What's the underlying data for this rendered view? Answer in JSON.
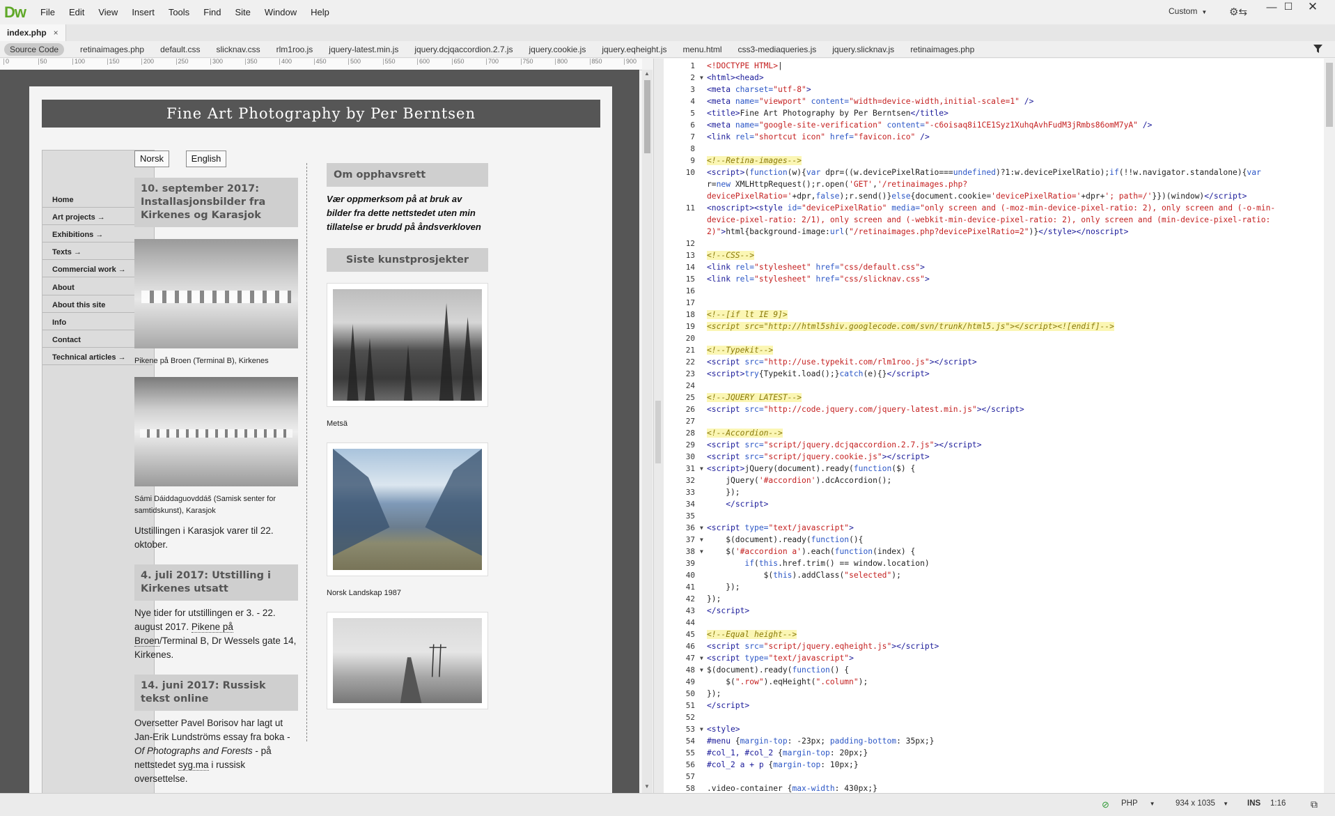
{
  "app": {
    "logo": "Dw",
    "menus": [
      "File",
      "Edit",
      "View",
      "Insert",
      "Tools",
      "Find",
      "Site",
      "Window",
      "Help"
    ],
    "workspace": "Custom",
    "icons": {
      "sync": "gear-sync-icon",
      "minimize": "minimize-icon",
      "maximize": "maximize-icon",
      "close": "close-icon",
      "filter": "filter-icon"
    }
  },
  "document_tab": {
    "label": "index.php",
    "close": "×"
  },
  "related_files": [
    "Source Code",
    "retinaimages.php",
    "default.css",
    "slicknav.css",
    "rlm1roo.js",
    "jquery-latest.min.js",
    "jquery.dcjqaccordion.2.7.js",
    "jquery.cookie.js",
    "jquery.eqheight.js",
    "menu.html",
    "css3-mediaqueries.js",
    "jquery.slicknav.js",
    "retinaimages.php"
  ],
  "ruler_ticks": [
    "0",
    "50",
    "100",
    "150",
    "200",
    "250",
    "300",
    "350",
    "400",
    "450",
    "500",
    "550",
    "600",
    "650",
    "700",
    "750",
    "800",
    "850",
    "900"
  ],
  "site": {
    "title": "Fine Art Photography by Per Berntsen",
    "nav": [
      "Home",
      "Art projects →",
      "Exhibitions →",
      "Texts →",
      "Commercial work →",
      "About",
      "About this site",
      "Info",
      "Contact",
      "Technical articles →"
    ],
    "lang_buttons": [
      "Norsk",
      "English"
    ],
    "news": [
      {
        "heading": "10. september 2017: Installasjonsbilder fra Kirkenes og Karasjok"
      },
      {
        "caption1": "Pikene på Broen (Terminal B), Kirkenes"
      },
      {
        "caption2": "Sámi Dáiddaguovddáš (Samisk senter for samtidskunst), Karasjok"
      },
      {
        "text": "Utstillingen i Karasjok varer til 22. oktober."
      },
      {
        "heading": "4. juli 2017: Utstilling i Kirkenes utsatt"
      },
      {
        "text_a": "Nye tider for utstillingen er 3. - 22. august 2017.",
        "text_b": "Pikene på Broen",
        "text_c": "/Terminal B, Dr Wessels gate 14, Kirkenes."
      },
      {
        "heading": "14. juni 2017: Russisk tekst online"
      },
      {
        "text_a": "Oversetter Pavel Borisov har lagt ut Jan-Erik Lundströms essay fra boka - ",
        "text_b": "Of Photographs and Forests",
        "text_c": " - på nettstedet ",
        "text_d": "syg.ma",
        "text_e": " i russisk oversettelse."
      }
    ],
    "sidebar": {
      "copyright_heading": "Om opphavsrett",
      "copyright_text": "Vær oppmerksom på at bruk av bilder fra dette nettstedet uten min tillatelse er brudd på åndsverkloven",
      "projects_heading": "Siste kunstprosjekter",
      "captions": [
        "Metsä",
        "Norsk Landskap 1987"
      ]
    }
  },
  "code": [
    {
      "n": "1",
      "f": "",
      "html": "<span class='dt'>&lt;!DOCTYPE HTML&gt;</span>|"
    },
    {
      "n": "2",
      "f": "▼",
      "html": "<span class='tag'>&lt;html&gt;&lt;head&gt;</span>"
    },
    {
      "n": "3",
      "f": "",
      "html": "<span class='tag'>&lt;meta</span> <span class='kw'>charset=</span><span class='str'>\"utf-8\"</span><span class='tag'>&gt;</span>"
    },
    {
      "n": "4",
      "f": "",
      "html": "<span class='tag'>&lt;meta</span> <span class='kw'>name=</span><span class='str'>\"viewport\"</span> <span class='kw'>content=</span><span class='str'>\"width=device-width,initial-scale=1\"</span> <span class='tag'>/&gt;</span>"
    },
    {
      "n": "5",
      "f": "",
      "html": "<span class='tag'>&lt;title&gt;</span>Fine Art Photography by Per Berntsen<span class='tag'>&lt;/title&gt;</span>"
    },
    {
      "n": "6",
      "f": "",
      "html": "<span class='tag'>&lt;meta</span> <span class='kw'>name=</span><span class='str'>\"google-site-verification\"</span> <span class='kw'>content=</span><span class='str'>\"-c6oisaq8i1CE1Syz1XuhqAvhFudM3jRmbs86omM7yA\"</span> <span class='tag'>/&gt;</span>"
    },
    {
      "n": "7",
      "f": "",
      "html": "<span class='tag'>&lt;link</span> <span class='kw'>rel=</span><span class='str'>\"shortcut icon\"</span> <span class='kw'>href=</span><span class='str'>\"favicon.ico\"</span> <span class='tag'>/&gt;</span>"
    },
    {
      "n": "8",
      "f": "",
      "html": ""
    },
    {
      "n": "9",
      "f": "",
      "html": "<span class='cm'>&lt;!--Retina-images--&gt;</span>"
    },
    {
      "n": "10",
      "f": "",
      "html": "<span class='tag'>&lt;script&gt;</span>(<span class='kw'>function</span>(w){<span class='kw'>var</span> dpr=((w.devicePixelRatio===<span class='kw'>undefined</span>)?1:w.devicePixelRatio);<span class='kw'>if</span>(!!w.navigator.standalone){<span class='kw'>var</span>"
    },
    {
      "n": "",
      "f": "",
      "html": "r=<span class='kw'>new</span> XMLHttpRequest();r.open(<span class='str'>'GET'</span>,<span class='str'>'/retinaimages.php?</span>"
    },
    {
      "n": "",
      "f": "",
      "html": "<span class='str'>devicePixelRatio='</span>+dpr,<span class='kw'>false</span>);r.send()}<span class='kw'>else</span>{document.cookie=<span class='str'>'devicePixelRatio='</span>+dpr+<span class='str'>'; path=/'</span>}})(window)<span class='tag'>&lt;/script&gt;</span>"
    },
    {
      "n": "11",
      "f": "",
      "html": "<span class='tag'>&lt;noscript&gt;&lt;style</span> <span class='kw'>id=</span><span class='str'>\"devicePixelRatio\"</span> <span class='kw'>media=</span><span class='str'>\"only screen and (-moz-min-device-pixel-ratio: 2), only screen and (-o-min-</span>"
    },
    {
      "n": "",
      "f": "",
      "html": "<span class='str'>device-pixel-ratio: 2/1), only screen and (-webkit-min-device-pixel-ratio: 2), only screen and (min-device-pixel-ratio:</span>"
    },
    {
      "n": "",
      "f": "",
      "html": "<span class='str'>2)\"</span><span class='tag'>&gt;</span>html{background-image:<span class='kw'>url</span>(<span class='str'>\"/retinaimages.php?devicePixelRatio=2\"</span>)}<span class='tag'>&lt;/style&gt;&lt;/noscript&gt;</span>"
    },
    {
      "n": "12",
      "f": "",
      "html": ""
    },
    {
      "n": "13",
      "f": "",
      "html": "<span class='cm'>&lt;!--CSS--&gt;</span>"
    },
    {
      "n": "14",
      "f": "",
      "html": "<span class='tag'>&lt;link</span> <span class='kw'>rel=</span><span class='str'>\"stylesheet\"</span> <span class='kw'>href=</span><span class='str'>\"css/default.css\"</span><span class='tag'>&gt;</span>"
    },
    {
      "n": "15",
      "f": "",
      "html": "<span class='tag'>&lt;link</span> <span class='kw'>rel=</span><span class='str'>\"stylesheet\"</span> <span class='kw'>href=</span><span class='str'>\"css/slicknav.css\"</span><span class='tag'>&gt;</span>"
    },
    {
      "n": "16",
      "f": "",
      "html": ""
    },
    {
      "n": "17",
      "f": "",
      "html": ""
    },
    {
      "n": "18",
      "f": "",
      "html": "<span class='cm'>&lt;!--[if lt IE 9]&gt;</span>"
    },
    {
      "n": "19",
      "f": "",
      "html": "<span class='cm'>&lt;script src=\"http://html5shiv.googlecode.com/svn/trunk/html5.js\"&gt;&lt;/script&gt;&lt;![endif]--&gt;</span>"
    },
    {
      "n": "20",
      "f": "",
      "html": ""
    },
    {
      "n": "21",
      "f": "",
      "html": "<span class='cm'>&lt;!--Typekit--&gt;</span>"
    },
    {
      "n": "22",
      "f": "",
      "html": "<span class='tag'>&lt;script</span> <span class='kw'>src=</span><span class='str'>\"http://use.typekit.com/rlm1roo.js\"</span><span class='tag'>&gt;&lt;/script&gt;</span>"
    },
    {
      "n": "23",
      "f": "",
      "html": "<span class='tag'>&lt;script&gt;</span><span class='kw'>try</span>{Typekit.load();}<span class='kw'>catch</span>(e){}<span class='tag'>&lt;/script&gt;</span>"
    },
    {
      "n": "24",
      "f": "",
      "html": ""
    },
    {
      "n": "25",
      "f": "",
      "html": "<span class='cm'>&lt;!--JQUERY LATEST--&gt;</span>"
    },
    {
      "n": "26",
      "f": "",
      "html": "<span class='tag'>&lt;script</span> <span class='kw'>src=</span><span class='str'>\"http://code.jquery.com/jquery-latest.min.js\"</span><span class='tag'>&gt;&lt;/script&gt;</span>"
    },
    {
      "n": "27",
      "f": "",
      "html": ""
    },
    {
      "n": "28",
      "f": "",
      "html": "<span class='cm'>&lt;!--Accordion--&gt;</span>"
    },
    {
      "n": "29",
      "f": "",
      "html": "<span class='tag'>&lt;script</span> <span class='kw'>src=</span><span class='str'>\"script/jquery.dcjqaccordion.2.7.js\"</span><span class='tag'>&gt;&lt;/script&gt;</span>"
    },
    {
      "n": "30",
      "f": "",
      "html": "<span class='tag'>&lt;script</span> <span class='kw'>src=</span><span class='str'>\"script/jquery.cookie.js\"</span><span class='tag'>&gt;&lt;/script&gt;</span>"
    },
    {
      "n": "31",
      "f": "▼",
      "html": "<span class='tag'>&lt;script&gt;</span>jQuery(document).ready(<span class='kw'>function</span>($) {"
    },
    {
      "n": "32",
      "f": "",
      "html": "    jQuery(<span class='str'>'#accordion'</span>).dcAccordion();"
    },
    {
      "n": "33",
      "f": "",
      "html": "    });"
    },
    {
      "n": "34",
      "f": "",
      "html": "    <span class='tag'>&lt;/script&gt;</span>"
    },
    {
      "n": "35",
      "f": "",
      "html": ""
    },
    {
      "n": "36",
      "f": "▼",
      "html": "<span class='tag'>&lt;script</span> <span class='kw'>type=</span><span class='str'>\"text/javascript\"</span><span class='tag'>&gt;</span>"
    },
    {
      "n": "37",
      "f": "▼",
      "html": "    $(document).ready(<span class='kw'>function</span>(){"
    },
    {
      "n": "38",
      "f": "▼",
      "html": "    $(<span class='str'>'#accordion a'</span>).each(<span class='kw'>function</span>(index) {"
    },
    {
      "n": "39",
      "f": "",
      "html": "        <span class='kw'>if</span>(<span class='kw'>this</span>.href.trim() == window.location)"
    },
    {
      "n": "40",
      "f": "",
      "html": "            $(<span class='kw'>this</span>).addClass(<span class='str'>\"selected\"</span>);"
    },
    {
      "n": "41",
      "f": "",
      "html": "    });"
    },
    {
      "n": "42",
      "f": "",
      "html": "});"
    },
    {
      "n": "43",
      "f": "",
      "html": "<span class='tag'>&lt;/script&gt;</span>"
    },
    {
      "n": "44",
      "f": "",
      "html": ""
    },
    {
      "n": "45",
      "f": "",
      "html": "<span class='cm'>&lt;!--Equal height--&gt;</span>"
    },
    {
      "n": "46",
      "f": "",
      "html": "<span class='tag'>&lt;script</span> <span class='kw'>src=</span><span class='str'>\"script/jquery.eqheight.js\"</span><span class='tag'>&gt;&lt;/script&gt;</span>"
    },
    {
      "n": "47",
      "f": "▼",
      "html": "<span class='tag'>&lt;script</span> <span class='kw'>type=</span><span class='str'>\"text/javascript\"</span><span class='tag'>&gt;</span>"
    },
    {
      "n": "48",
      "f": "▼",
      "html": "$(document).ready(<span class='kw'>function</span>() {"
    },
    {
      "n": "49",
      "f": "",
      "html": "    $(<span class='str'>\".row\"</span>).eqHeight(<span class='str'>\".column\"</span>);"
    },
    {
      "n": "50",
      "f": "",
      "html": "});"
    },
    {
      "n": "51",
      "f": "",
      "html": "<span class='tag'>&lt;/script&gt;</span>"
    },
    {
      "n": "52",
      "f": "",
      "html": ""
    },
    {
      "n": "53",
      "f": "▼",
      "html": "<span class='tag'>&lt;style&gt;</span>"
    },
    {
      "n": "54",
      "f": "",
      "html": "<span class='tag'>#menu</span> {<span class='kw'>margin-top</span>: -23px; <span class='kw'>padding-bottom</span>: 35px;}"
    },
    {
      "n": "55",
      "f": "",
      "html": "<span class='tag'>#col_1, #col_2</span> {<span class='kw'>margin-top</span>: 20px;}"
    },
    {
      "n": "56",
      "f": "",
      "html": "<span class='tag'>#col_2 a + p</span> {<span class='kw'>margin-top</span>: 10px;}"
    },
    {
      "n": "57",
      "f": "",
      "html": ""
    },
    {
      "n": "58",
      "f": "",
      "html": ".video-container {<span class='kw'>max-width</span>: 430px;}"
    }
  ],
  "status": {
    "ok_icon": "check-circle-icon",
    "language": "PHP",
    "size": "934 x 1035",
    "ins": "INS",
    "position": "1:16",
    "preview_icon": "preview-icon"
  }
}
